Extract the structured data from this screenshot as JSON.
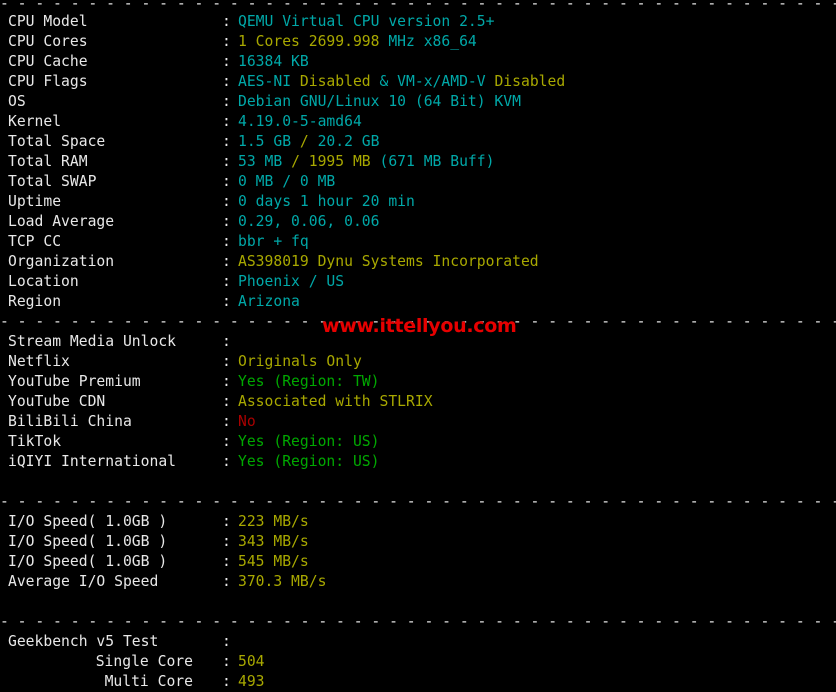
{
  "terminal": {
    "background": "#000000",
    "foreground": "#e8e8e8",
    "colors": {
      "cyan": "#00a8a8",
      "yellow": "#a8a800",
      "green": "#00a800",
      "red": "#a80000",
      "white": "#e8e8e8",
      "watermark_red": "#e70000"
    },
    "divider": "- - - - - - - - - - - - - - - - - - - - - - - - - - - - - - - - - - - - - - - - - - - - - - - - - - - - - - - - - - - - - - - - - - - - - - - - -",
    "colon": ":"
  },
  "watermark": {
    "text": "www.ittellyou.com"
  },
  "sections": {
    "system": {
      "rows": [
        {
          "label": "CPU Model",
          "segments": [
            {
              "text": "QEMU Virtual CPU version 2.5+",
              "color": "cyan"
            }
          ]
        },
        {
          "label": "CPU Cores",
          "segments": [
            {
              "text": "1 Cores 2699.998 ",
              "color": "yellow"
            },
            {
              "text": "MHz x86_64",
              "color": "cyan"
            }
          ]
        },
        {
          "label": "CPU Cache",
          "segments": [
            {
              "text": "16384 KB",
              "color": "cyan"
            }
          ]
        },
        {
          "label": "CPU Flags",
          "segments": [
            {
              "text": "AES-NI ",
              "color": "cyan"
            },
            {
              "text": "Disabled",
              "color": "yellow"
            },
            {
              "text": " & VM-x/AMD-V ",
              "color": "cyan"
            },
            {
              "text": "Disabled",
              "color": "yellow"
            }
          ]
        },
        {
          "label": "OS",
          "segments": [
            {
              "text": "Debian GNU/Linux 10 (64 Bit) KVM",
              "color": "cyan"
            }
          ]
        },
        {
          "label": "Kernel",
          "segments": [
            {
              "text": "4.19.0-5-amd64",
              "color": "cyan"
            }
          ]
        },
        {
          "label": "Total Space",
          "segments": [
            {
              "text": "1.5 GB ",
              "color": "cyan"
            },
            {
              "text": "/ ",
              "color": "yellow"
            },
            {
              "text": "20.2 GB",
              "color": "cyan"
            }
          ]
        },
        {
          "label": "Total RAM",
          "segments": [
            {
              "text": "53 MB ",
              "color": "cyan"
            },
            {
              "text": "/ 1995 MB ",
              "color": "yellow"
            },
            {
              "text": "(671 MB Buff)",
              "color": "cyan"
            }
          ]
        },
        {
          "label": "Total SWAP",
          "segments": [
            {
              "text": "0 MB / 0 MB",
              "color": "cyan"
            }
          ]
        },
        {
          "label": "Uptime",
          "segments": [
            {
              "text": "0 days 1 hour 20 min",
              "color": "cyan"
            }
          ]
        },
        {
          "label": "Load Average",
          "segments": [
            {
              "text": "0.29, 0.06, 0.06",
              "color": "cyan"
            }
          ]
        },
        {
          "label": "TCP CC",
          "segments": [
            {
              "text": "bbr + fq",
              "color": "cyan"
            }
          ]
        },
        {
          "label": "Organization",
          "segments": [
            {
              "text": "AS398019 Dynu Systems Incorporated",
              "color": "yellow"
            }
          ]
        },
        {
          "label": "Location",
          "segments": [
            {
              "text": "Phoenix / US",
              "color": "cyan"
            }
          ]
        },
        {
          "label": "Region",
          "segments": [
            {
              "text": "Arizona",
              "color": "cyan"
            }
          ]
        }
      ]
    },
    "stream_media": {
      "rows": [
        {
          "label": "Stream Media Unlock",
          "segments": []
        },
        {
          "label": "Netflix",
          "segments": [
            {
              "text": "Originals Only",
              "color": "yellow"
            }
          ]
        },
        {
          "label": "YouTube Premium",
          "segments": [
            {
              "text": "Yes (Region: TW)",
              "color": "green"
            }
          ]
        },
        {
          "label": "YouTube CDN",
          "segments": [
            {
              "text": "Associated with STLRIX",
              "color": "yellow"
            }
          ]
        },
        {
          "label": "BiliBili China",
          "segments": [
            {
              "text": "No",
              "color": "red"
            }
          ]
        },
        {
          "label": "TikTok",
          "segments": [
            {
              "text": "Yes (Region: US)",
              "color": "green"
            }
          ]
        },
        {
          "label": "iQIYI International",
          "segments": [
            {
              "text": "Yes (Region: US)",
              "color": "green"
            }
          ]
        }
      ]
    },
    "io_speed": {
      "rows": [
        {
          "label": "I/O Speed( 1.0GB )",
          "segments": [
            {
              "text": "223 MB/s",
              "color": "yellow"
            }
          ]
        },
        {
          "label": "I/O Speed( 1.0GB )",
          "segments": [
            {
              "text": "343 MB/s",
              "color": "yellow"
            }
          ]
        },
        {
          "label": "I/O Speed( 1.0GB )",
          "segments": [
            {
              "text": "545 MB/s",
              "color": "yellow"
            }
          ]
        },
        {
          "label": "Average I/O Speed",
          "segments": [
            {
              "text": "370.3 MB/s",
              "color": "yellow"
            }
          ]
        }
      ]
    },
    "geekbench": {
      "rows": [
        {
          "label": "Geekbench v5 Test",
          "indent": false,
          "segments": []
        },
        {
          "label": "Single Core",
          "indent": true,
          "segments": [
            {
              "text": "504",
              "color": "yellow"
            }
          ]
        },
        {
          "label": "Multi Core",
          "indent": true,
          "segments": [
            {
              "text": "493",
              "color": "yellow"
            }
          ]
        }
      ]
    }
  }
}
